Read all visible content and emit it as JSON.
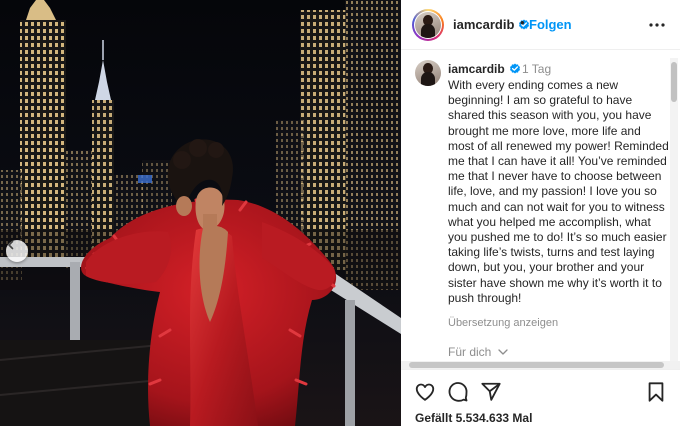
{
  "post": {
    "username": "iamcardib",
    "follow_label": "Folgen",
    "separator": "•",
    "time_ago": "1 Tag",
    "caption": "With every ending comes a new beginning! I am so grateful to have shared this season with you, you have brought me more love, more life and most of all renewed my power! Reminded me that I can have it all! You’ve reminded me that I never have to choose between life, love, and my passion! I love you so much and can not wait for you to witness what you helped me accomplish, what you pushed me to do! It’s so much easier taking life’s twists, turns and test laying down, but you, your brother and your sister have shown me why it’s worth it to push through!",
    "translate_label": "Übersetzung anzeigen",
    "for_you_label": "Für dich",
    "likes_label": "Gefällt 5.534.633 Mal"
  },
  "icons": {
    "verified": "verified-badge-icon",
    "more": "more-options-icon",
    "prev": "chevron-left-icon",
    "like": "heart-icon",
    "comment": "comment-icon",
    "share": "send-icon",
    "save": "bookmark-icon"
  },
  "colors": {
    "accent": "#0095f6",
    "muted": "#8e8e8e",
    "text": "#262626",
    "dress": "#c01a1e"
  }
}
